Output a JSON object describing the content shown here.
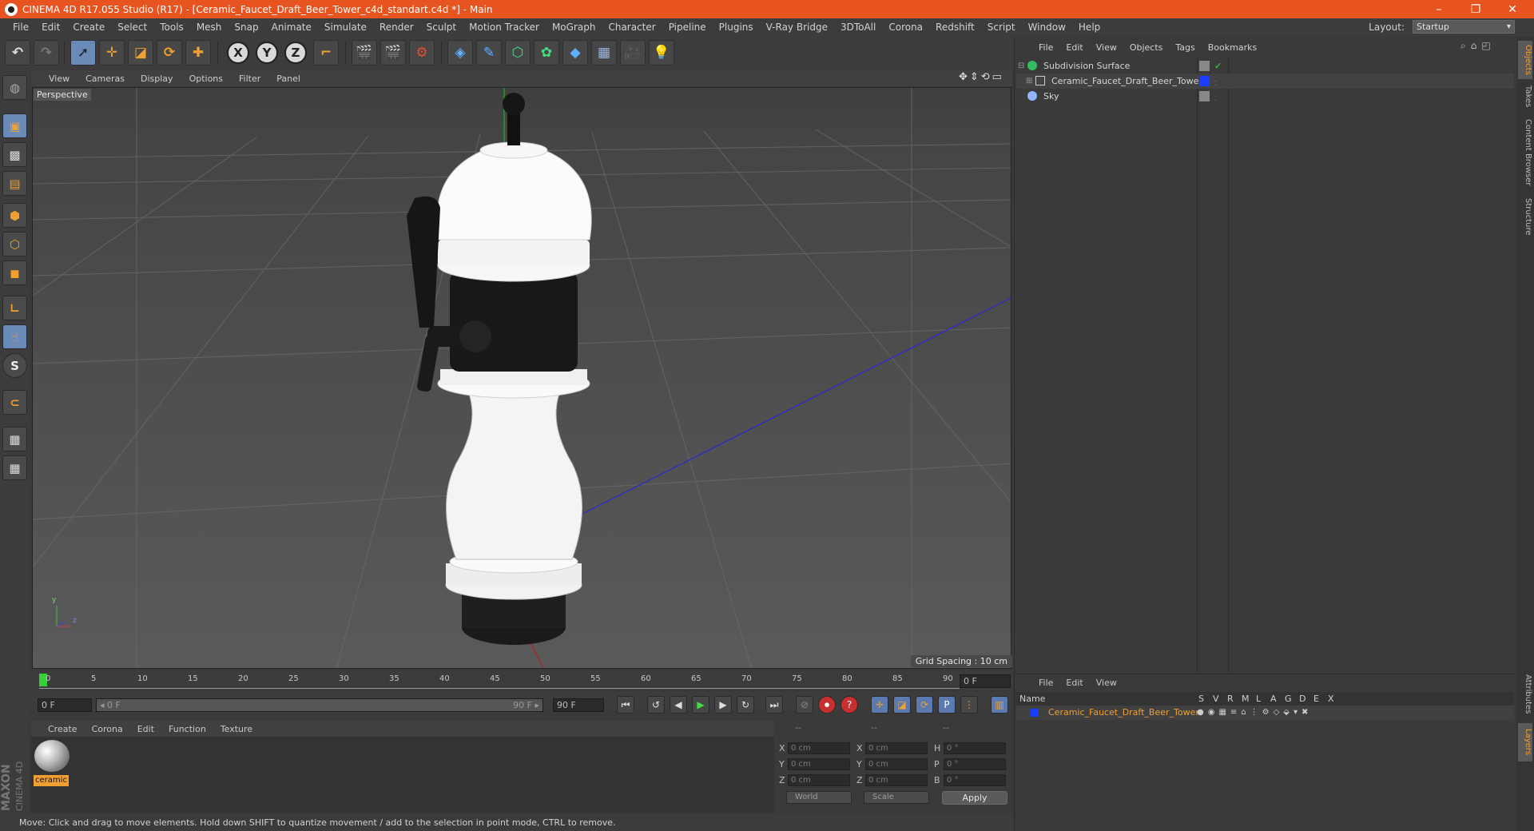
{
  "window": {
    "title": "CINEMA 4D R17.055 Studio (R17) - [Ceramic_Faucet_Draft_Beer_Tower_c4d_standart.c4d *] - Main",
    "minimize": "–",
    "maximize": "❐",
    "close": "✕"
  },
  "menu": [
    "File",
    "Edit",
    "Create",
    "Select",
    "Tools",
    "Mesh",
    "Snap",
    "Animate",
    "Simulate",
    "Render",
    "Sculpt",
    "Motion Tracker",
    "MoGraph",
    "Character",
    "Pipeline",
    "Plugins",
    "V-Ray Bridge",
    "3DToAll",
    "Corona",
    "Redshift",
    "Script",
    "Window",
    "Help"
  ],
  "layout": {
    "label": "Layout:",
    "value": "Startup"
  },
  "toolbar": {
    "x": "X",
    "y": "Y",
    "z": "Z"
  },
  "viewport": {
    "menu": [
      "View",
      "Cameras",
      "Display",
      "Options",
      "Filter",
      "Panel"
    ],
    "label": "Perspective",
    "grid_spacing": "Grid Spacing : 10 cm",
    "axis_y": "y",
    "axis_z": "z"
  },
  "timeline": {
    "ticks": [
      "0",
      "5",
      "10",
      "15",
      "20",
      "25",
      "30",
      "35",
      "40",
      "45",
      "50",
      "55",
      "60",
      "65",
      "70",
      "75",
      "80",
      "85",
      "90"
    ],
    "current": "0 F",
    "start": "0 F",
    "range_start": "◂ 0 F",
    "range_end": "90 F ▸",
    "end": "90 F",
    "end2": "90 F"
  },
  "materials": {
    "menu": [
      "Create",
      "Corona",
      "Edit",
      "Function",
      "Texture"
    ],
    "items": [
      {
        "name": "ceramic"
      }
    ],
    "brand1": "MAXON",
    "brand2": "CINEMA 4D"
  },
  "coords": {
    "header": [
      "--",
      "--",
      "--"
    ],
    "rows": [
      {
        "a": "X",
        "av": "0 cm",
        "b": "X",
        "bv": "0 cm",
        "c": "H",
        "cv": "0 °"
      },
      {
        "a": "Y",
        "av": "0 cm",
        "b": "Y",
        "bv": "0 cm",
        "c": "P",
        "cv": "0 °"
      },
      {
        "a": "Z",
        "av": "0 cm",
        "b": "Z",
        "bv": "0 cm",
        "c": "B",
        "cv": "0 °"
      }
    ],
    "space": "World",
    "mode": "Scale",
    "apply": "Apply"
  },
  "status": "Move: Click and drag to move elements. Hold down SHIFT to quantize movement / add to the selection in point mode, CTRL to remove.",
  "objects": {
    "menu": [
      "File",
      "Edit",
      "View",
      "Objects",
      "Tags",
      "Bookmarks"
    ],
    "items": [
      {
        "name": "Subdivision Surface",
        "check": "✓"
      },
      {
        "name": "Ceramic_Faucet_Draft_Beer_Tower",
        "layer_color": "#1a3cff"
      },
      {
        "name": "Sky"
      }
    ]
  },
  "attributes": {
    "menu": [
      "File",
      "Edit",
      "View"
    ],
    "headers": [
      "Name",
      "S",
      "V",
      "R",
      "M",
      "L",
      "A",
      "G",
      "D",
      "E",
      "X"
    ],
    "row": "Ceramic_Faucet_Draft_Beer_Tower"
  },
  "right_tabs": [
    "Objects",
    "Takes",
    "Content Browser",
    "Structure",
    "Attributes",
    "Layers"
  ],
  "colors": {
    "titlebar": "#e8541f",
    "accent": "#f0a030",
    "selected": "#6a8ab8"
  }
}
